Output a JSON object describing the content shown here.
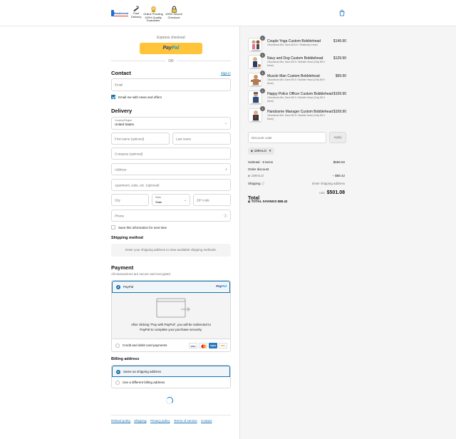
{
  "header": {
    "logo_text": "Bobblehead",
    "badges": [
      {
        "label": "Fast\nDelivery",
        "icon": "fast-delivery-icon"
      },
      {
        "label": "Online Proofing\n100% Quality\nGuarantee",
        "icon": "quality-award-icon"
      },
      {
        "label": "100% Secure\nCheckout",
        "icon": "secure-lock-icon"
      }
    ],
    "cart_icon": "shopping-bag-icon"
  },
  "express": {
    "label": "Express checkout",
    "paypal_1": "Pay",
    "paypal_2": "Pal",
    "or": "OR"
  },
  "contact": {
    "heading": "Contact",
    "sign_in": "Sign in",
    "email_placeholder": "Email",
    "news_label": "Email me with news and offers"
  },
  "delivery": {
    "heading": "Delivery",
    "country_label": "Country/Region",
    "country_value": "United States",
    "first_name": "First name (optional)",
    "last_name": "Last name",
    "company": "Company (optional)",
    "address": "Address",
    "apartment": "Apartment, suite, etc. (optional)",
    "city": "City",
    "state_label": "State",
    "state_value": "State",
    "zip": "ZIP code",
    "phone": "Phone",
    "save_label": "Save this information for next time"
  },
  "shipping_method": {
    "heading": "Shipping method",
    "note": "Enter your shipping address to view available shipping methods."
  },
  "payment": {
    "heading": "Payment",
    "subtitle": "All transactions are secure and encrypted.",
    "paypal_label": "PayPal",
    "paypal_brand_1": "Pay",
    "paypal_brand_2": "Pal",
    "description": "After clicking “Pay with PayPal”, you will be redirected to PayPal to complete your purchase securely.",
    "card_label": "Credit and debit card payments",
    "cards": [
      {
        "name": "VISA",
        "color": "#1a1f71"
      },
      {
        "name": "MC",
        "color": "#eb001b"
      },
      {
        "name": "AMEX",
        "color": "#2e77bc"
      },
      {
        "name": "DISC",
        "color": "#f58220"
      }
    ]
  },
  "billing": {
    "heading": "Billing address",
    "option_same": "Same as shipping address",
    "option_diff": "Use a different billing address"
  },
  "footer_links": [
    "Refund policy",
    "Shipping",
    "Privacy policy",
    "Terms of service",
    "Contact"
  ],
  "order": {
    "items": [
      {
        "name": "Couple Yoga Custom Bobblehead",
        "desc": "15oz/about 8in; Save $16.9 / Stationary Head",
        "price": "$149.90",
        "qty": "1"
      },
      {
        "name": "Navy and Dog Custom Bobblehead",
        "desc": "15oz/about 8in; Save $9.9 / Bobble Head (Only $9.9 More)",
        "price": "$129.90",
        "qty": "1"
      },
      {
        "name": "Muscle Man Custom Bobblehead",
        "desc": "15oz/about 8in; Save $9.9 / Bobble Head (Only $9.9 More)",
        "price": "$99.90",
        "qty": "1"
      },
      {
        "name": "Happy Police Officer Custom Bobblehead",
        "desc": "15oz/about 8in; Save $9.9 / Bobble Head (Only $9.9 More)",
        "price": "$109.90",
        "qty": "1"
      },
      {
        "name": "Handsome Manager Custom Bobblehead",
        "desc": "15oz/about 8in; Save $9.9 / Bobble Head (Only $9.9 More)",
        "price": "$109.90",
        "qty": "1"
      }
    ],
    "discount_placeholder": "Discount code",
    "apply": "Apply",
    "applied_code": "15RALO",
    "subtotal_label": "Subtotal · 5 items",
    "subtotal_value": "$589.50",
    "order_discount_label": "Order discount",
    "discount_code": "15RALO",
    "discount_value": "− $88.42",
    "shipping_label": "Shipping",
    "shipping_value": "Enter shipping address",
    "total_label": "Total",
    "total_currency": "USD",
    "total_value": "$501.08",
    "savings_label": "TOTAL SAVINGS",
    "savings_value": "$88.42"
  }
}
